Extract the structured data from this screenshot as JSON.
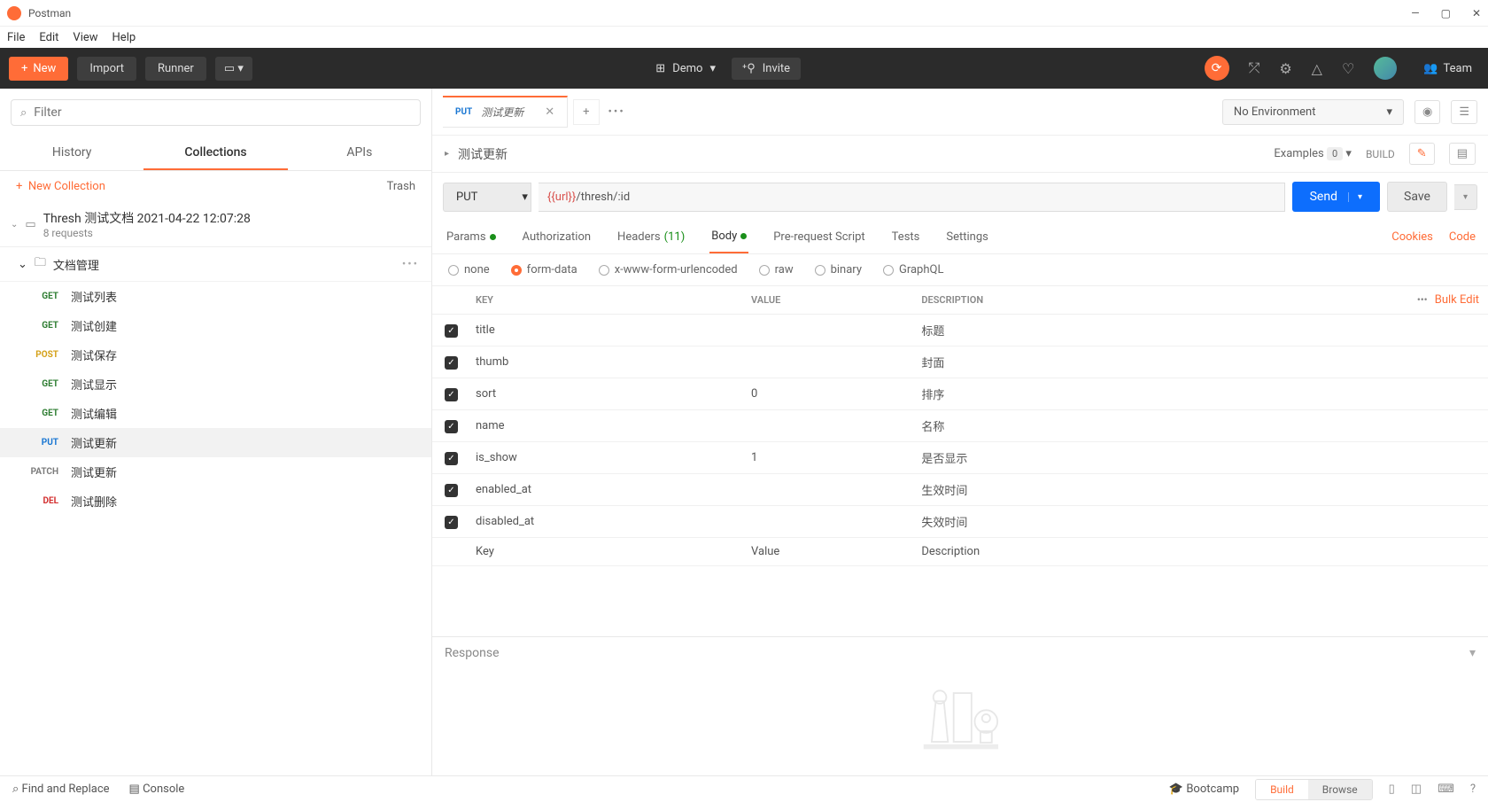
{
  "app": {
    "title": "Postman"
  },
  "menu": {
    "file": "File",
    "edit": "Edit",
    "view": "View",
    "help": "Help"
  },
  "toolbar": {
    "new": "New",
    "import": "Import",
    "runner": "Runner",
    "workspace": "Demo",
    "invite": "Invite",
    "team": "Team"
  },
  "sidebar": {
    "filter_placeholder": "Filter",
    "tabs": {
      "history": "History",
      "collections": "Collections",
      "apis": "APIs"
    },
    "new_collection": "New Collection",
    "trash": "Trash",
    "collection": {
      "name": "Thresh 测试文档 2021-04-22 12:07:28",
      "sub": "8 requests",
      "folder": "文档管理",
      "requests": [
        {
          "method": "GET",
          "cls": "m-get",
          "name": "测试列表"
        },
        {
          "method": "GET",
          "cls": "m-get",
          "name": "测试创建"
        },
        {
          "method": "POST",
          "cls": "m-post",
          "name": "测试保存"
        },
        {
          "method": "GET",
          "cls": "m-get",
          "name": "测试显示"
        },
        {
          "method": "GET",
          "cls": "m-get",
          "name": "测试编辑"
        },
        {
          "method": "PUT",
          "cls": "m-put",
          "name": "测试更新"
        },
        {
          "method": "PATCH",
          "cls": "m-patch",
          "name": "测试更新"
        },
        {
          "method": "DEL",
          "cls": "m-del",
          "name": "测试删除"
        }
      ]
    }
  },
  "request": {
    "tab_method": "PUT",
    "tab_name": "测试更新",
    "env": "No Environment",
    "breadcrumb": "测试更新",
    "examples_label": "Examples",
    "examples_count": "0",
    "build_label": "BUILD",
    "method": "PUT",
    "url_var": "{{url}}",
    "url_path": "/thresh/:id",
    "send": "Send",
    "save": "Save",
    "subtabs": {
      "params": "Params",
      "auth": "Authorization",
      "headers": "Headers",
      "headers_count": "(11)",
      "body": "Body",
      "prereq": "Pre-request Script",
      "tests": "Tests",
      "settings": "Settings",
      "cookies": "Cookies",
      "code": "Code"
    },
    "body_types": {
      "none": "none",
      "form": "form-data",
      "xwww": "x-www-form-urlencoded",
      "raw": "raw",
      "binary": "binary",
      "graphql": "GraphQL"
    },
    "table": {
      "hdr_key": "KEY",
      "hdr_value": "VALUE",
      "hdr_desc": "DESCRIPTION",
      "bulk": "Bulk Edit",
      "rows": [
        {
          "key": "title",
          "value": "",
          "desc": "标题"
        },
        {
          "key": "thumb",
          "value": "",
          "desc": "封面"
        },
        {
          "key": "sort",
          "value": "0",
          "desc": "排序"
        },
        {
          "key": "name",
          "value": "",
          "desc": "名称"
        },
        {
          "key": "is_show",
          "value": "1",
          "desc": "是否显示"
        },
        {
          "key": "enabled_at",
          "value": "",
          "desc": "生效时间"
        },
        {
          "key": "disabled_at",
          "value": "",
          "desc": "失效时间"
        }
      ],
      "ph_key": "Key",
      "ph_value": "Value",
      "ph_desc": "Description"
    },
    "response_label": "Response"
  },
  "status": {
    "find": "Find and Replace",
    "console": "Console",
    "bootcamp": "Bootcamp",
    "build": "Build",
    "browse": "Browse"
  }
}
